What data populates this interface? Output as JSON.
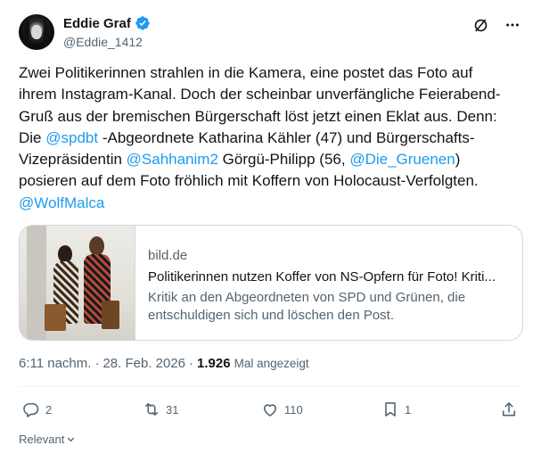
{
  "author": {
    "display_name": "Eddie Graf",
    "handle": "@Eddie_1412",
    "verified_icon": "verified-badge-icon"
  },
  "top_actions": {
    "grok_icon": "grok-icon",
    "more_icon": "more-icon"
  },
  "tweet": {
    "line1": "Zwei Politikerinnen strahlen in die Kamera, eine postet das Foto auf",
    "line2": "ihrem Instagram-Kanal. Doch der scheinbar unverfängliche Feierabend-",
    "line3": "Gruß aus der bremischen Bürgerschaft löst jetzt einen Eklat aus. Denn:",
    "line4_pre": "Die ",
    "mention1": "@spdbt",
    "line4_post": " -Abgeordnete Katharina Kähler (47) und Bürgerschafts-",
    "line5_pre": "Vizepräsidentin ",
    "mention2": "@Sahhanim2",
    "line5_mid": " Görgü-Philipp (56, ",
    "mention3": "@Die_Gruenen",
    "line5_post": ")",
    "line6": "posieren auf dem Foto fröhlich mit Koffern von Holocaust-Verfolgten.",
    "mention4": "@WolfMalca"
  },
  "card": {
    "domain": "bild.de",
    "title": "Politikerinnen nutzen Koffer von NS-Opfern für Foto! Kriti...",
    "description": "Kritik an den Abgeordneten von SPD und Grünen, die entschuldigen sich und löschen den Post."
  },
  "meta": {
    "time": "6:11 nachm.",
    "separator": "·",
    "date": "28. Feb. 2026",
    "separator2": "·",
    "views_count": "1.926",
    "views_label": "Mal angezeigt"
  },
  "actions": {
    "replies": "2",
    "reposts": "31",
    "likes": "110",
    "bookmarks": "1"
  },
  "footer": {
    "relevant_label": "Relevant"
  },
  "colors": {
    "link": "#1d9bf0",
    "secondary_text": "#536471",
    "primary_text": "#0f1419",
    "border": "#cfd9de"
  }
}
